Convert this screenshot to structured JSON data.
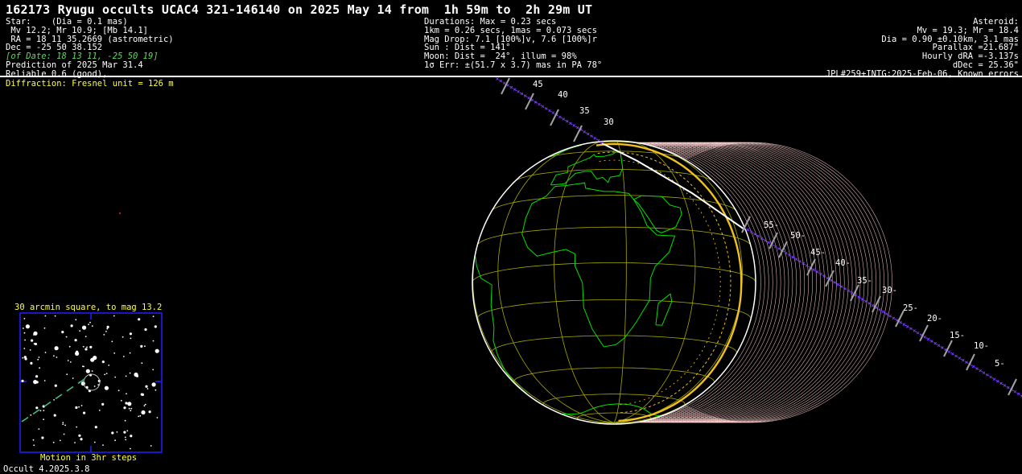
{
  "header": {
    "title": "162173 Ryugu occults UCAC4 321-146140 on 2025 May 14 from  1h 59m to  2h 29m UT"
  },
  "star_info": [
    {
      "text": "Star:    (Dia = 0.1 mas)",
      "color": "white"
    },
    {
      "text": " Mv 12.2; Mr 10.9; [Mb 14.1]",
      "color": "white"
    },
    {
      "text": " RA = 18 11 35.2669 (astrometric)",
      "color": "white"
    },
    {
      "text": "Dec = -25 50 38.152",
      "color": "white"
    },
    {
      "text": "[of Date: 18 13 11, -25 50 19]",
      "color": "green"
    },
    {
      "text": "Prediction of 2025 Mar 31.4",
      "color": "white"
    },
    {
      "text": "Reliable 0.6 (good),",
      "color": "white"
    }
  ],
  "event_info": [
    "Durations: Max = 0.23 secs",
    "1km = 0.26 secs, 1mas = 0.073 secs",
    "Mag Drop: 7.1 [100%]v, 7.6 [100%]r",
    "Sun : Dist = 141°",
    "Moon: Dist =  24°, illum = 98%",
    "1σ Err: ±(51.7 x 3.7) mas in PA 78°"
  ],
  "asteroid_info": [
    "Asteroid:",
    "Mv = 19.3; Mr = 18.4",
    "Dia = 0.90 ±0.10km, 3.1 mas",
    "Parallax =21.687\"",
    "Hourly dRA =-3.137s",
    "dDec = 25.36\"",
    "JPL#259+INTG:2025-Feb-06, Known errors"
  ],
  "diffraction": "Diffraction: Fresnel unit = 126 m",
  "path_ticks_upper": [
    "45",
    "40",
    "35",
    "30"
  ],
  "path_ticks_lower": [
    "55-",
    "50-",
    "45-",
    "40-",
    "35-",
    "30-",
    "25-",
    "20-",
    "15-",
    "10-",
    "5-"
  ],
  "finder_chart": {
    "title": "30 arcmin square, to mag 13.2",
    "motion": "Motion in 3hr steps"
  },
  "version": "Occult 4.2025.3.8",
  "colors": {
    "background": "#000000",
    "coastline": "#00e000",
    "graticule": "#a8a800",
    "path_center": "#ffffff",
    "path_limit": "#f0c020",
    "shadow_rings": "#ffd0d0",
    "track": "#8040ff",
    "annotation": "#ffff40",
    "finder_border": "#2020ff"
  }
}
